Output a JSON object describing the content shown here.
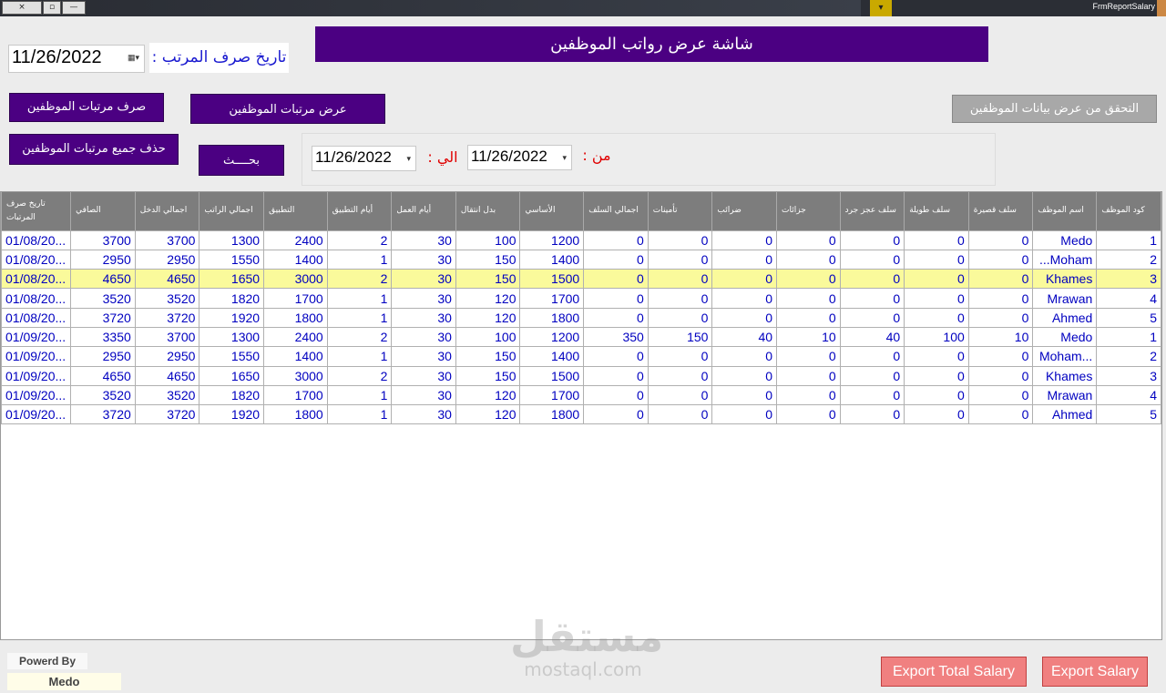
{
  "window": {
    "title": "FrmReportSalary",
    "close_icon": "×",
    "restore_icon": "▫",
    "min_icon": "—"
  },
  "header": {
    "title": "شاشة عرض رواتب الموظفين"
  },
  "pay_date": {
    "label": "تاريخ صرف المرتب :",
    "value": "11/26/2022"
  },
  "buttons": {
    "pay_salaries": "صرف مرتبات الموظفين",
    "show_salaries": "عرض مرتبات الموظفين",
    "delete_all": "حذف جميع مرتبات الموظفين",
    "search": "بحــــث",
    "verify": "التحقق من عرض بيانات الموظفين",
    "export_total": "Export Total Salary",
    "export": "Export Salary"
  },
  "filter": {
    "from_label": "من :",
    "from_value": "11/26/2022",
    "to_label": "الي :",
    "to_value": "11/26/2022"
  },
  "table": {
    "columns": [
      "كود الموظف",
      "اسم الموظف",
      "سلف قصيرة",
      "سلف طويلة",
      "سلف عجز جرد",
      "جزائات",
      "ضرائب",
      "تأمينات",
      "اجمالي السلف",
      "الأساسي",
      "بدل انتقال",
      "أيام العمل",
      "أيام التطبيق",
      "التطبيق",
      "اجمالي الراتب",
      "اجمالي الدخل",
      "الصافي",
      "تاريخ صرف المرتبات"
    ],
    "selected_row": 2,
    "rows": [
      [
        "1",
        "Medo",
        "0",
        "0",
        "0",
        "0",
        "0",
        "0",
        "0",
        "1200",
        "100",
        "30",
        "2",
        "2400",
        "1300",
        "3700",
        "3700",
        "01/08/20..."
      ],
      [
        "2",
        "Moham...",
        "0",
        "0",
        "0",
        "0",
        "0",
        "0",
        "0",
        "1400",
        "150",
        "30",
        "1",
        "1400",
        "1550",
        "2950",
        "2950",
        "01/08/20..."
      ],
      [
        "3",
        "Khames",
        "0",
        "0",
        "0",
        "0",
        "0",
        "0",
        "0",
        "1500",
        "150",
        "30",
        "2",
        "3000",
        "1650",
        "4650",
        "4650",
        "01/08/20..."
      ],
      [
        "4",
        "Mrawan",
        "0",
        "0",
        "0",
        "0",
        "0",
        "0",
        "0",
        "1700",
        "120",
        "30",
        "1",
        "1700",
        "1820",
        "3520",
        "3520",
        "01/08/20..."
      ],
      [
        "5",
        "Ahmed",
        "0",
        "0",
        "0",
        "0",
        "0",
        "0",
        "0",
        "1800",
        "120",
        "30",
        "1",
        "1800",
        "1920",
        "3720",
        "3720",
        "01/08/20..."
      ],
      [
        "1",
        "Medo",
        "10",
        "100",
        "40",
        "10",
        "40",
        "150",
        "350",
        "1200",
        "100",
        "30",
        "2",
        "2400",
        "1300",
        "3700",
        "3350",
        "01/09/20..."
      ],
      [
        "2",
        "...Moham",
        "0",
        "0",
        "0",
        "0",
        "0",
        "0",
        "0",
        "1400",
        "150",
        "30",
        "1",
        "1400",
        "1550",
        "2950",
        "2950",
        "01/09/20..."
      ],
      [
        "3",
        "Khames",
        "0",
        "0",
        "0",
        "0",
        "0",
        "0",
        "0",
        "1500",
        "150",
        "30",
        "2",
        "3000",
        "1650",
        "4650",
        "4650",
        "01/09/20..."
      ],
      [
        "4",
        "Mrawan",
        "0",
        "0",
        "0",
        "0",
        "0",
        "0",
        "0",
        "1700",
        "120",
        "30",
        "1",
        "1700",
        "1820",
        "3520",
        "3520",
        "01/09/20..."
      ],
      [
        "5",
        "Ahmed",
        "0",
        "0",
        "0",
        "0",
        "0",
        "0",
        "0",
        "1800",
        "120",
        "30",
        "1",
        "1800",
        "1920",
        "3720",
        "3720",
        "01/09/20..."
      ]
    ]
  },
  "footer": {
    "powered_by": "Powerd By",
    "author": "Medo",
    "watermark_ar": "مستقل",
    "watermark_lat": "mostaql.com"
  },
  "colors": {
    "accent": "#4b0082",
    "export": "#f08080",
    "selected_row": "#fafa9b",
    "cell_text": "#0000c0",
    "label_red": "#e00000",
    "label_blue": "#1a1ad0"
  }
}
